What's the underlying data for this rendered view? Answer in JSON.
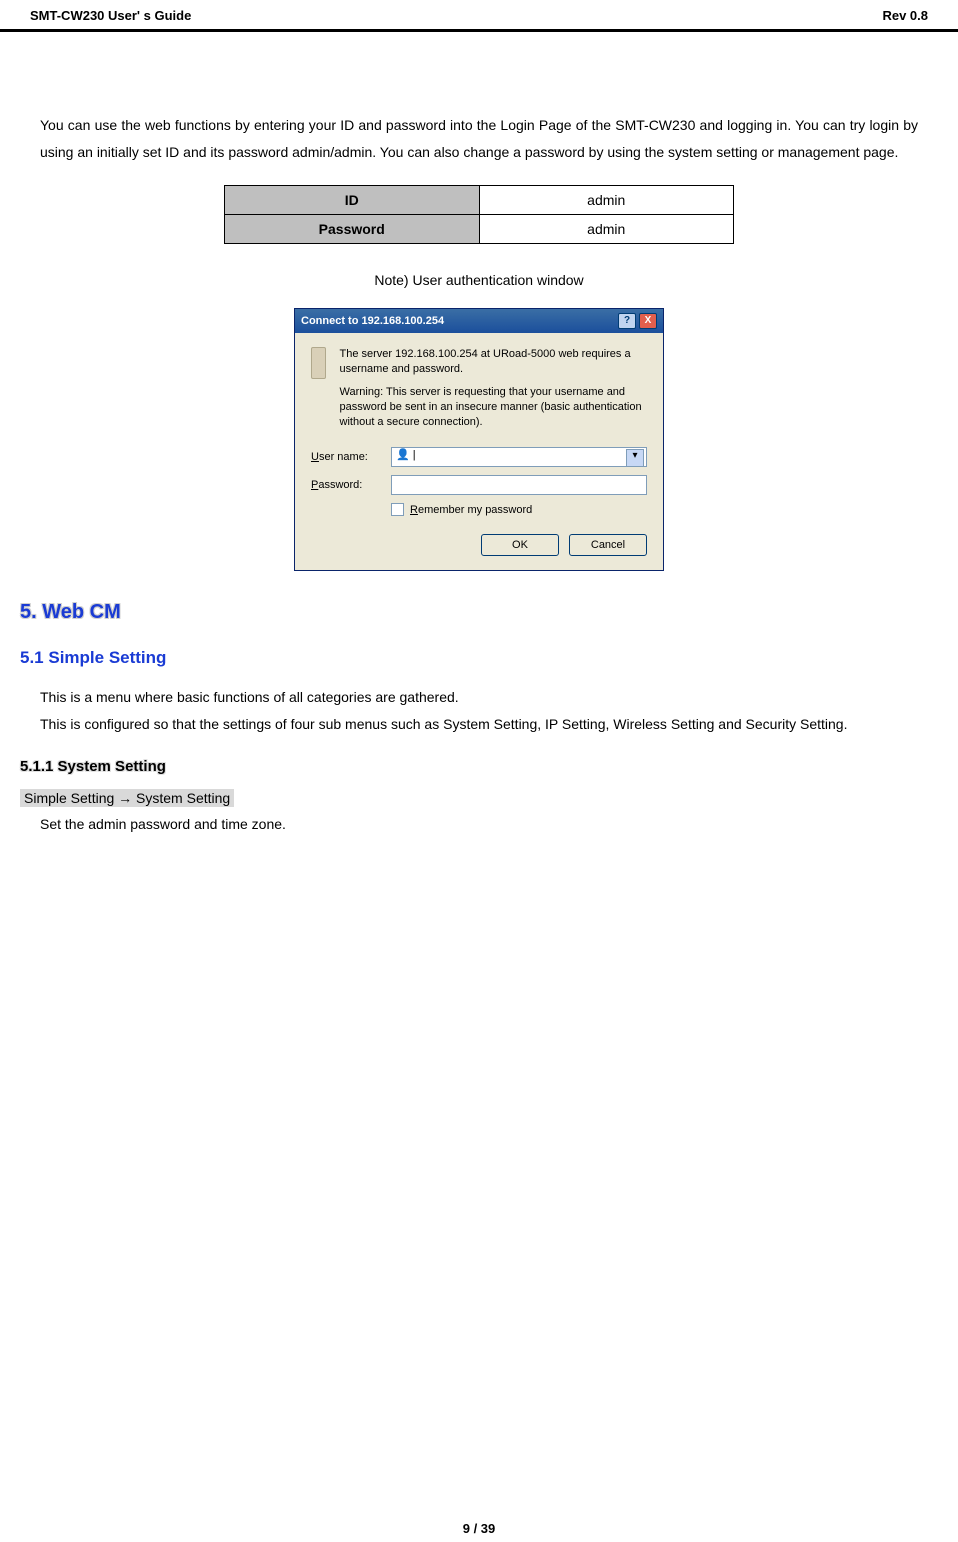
{
  "header": {
    "left": "SMT-CW230 User' s Guide",
    "right": "Rev 0.8"
  },
  "intro_paragraph": "You can use the web functions by entering your ID and password into the Login Page of the SMT-CW230 and logging in. You can try login by using an initially set ID and its password admin/admin. You can also change a password by using the system setting or management page.",
  "cred_table": {
    "id_label": "ID",
    "id_value": "admin",
    "pw_label": "Password",
    "pw_value": "admin"
  },
  "note_line": "Note)  User authentication window",
  "dialog": {
    "title": "Connect to 192.168.100.254",
    "help_glyph": "?",
    "close_glyph": "X",
    "line1": "The server 192.168.100.254 at URoad-5000 web requires a username and password.",
    "line2": "Warning: This server is requesting that your username and password be sent in an insecure manner (basic authentication without a secure connection).",
    "user_label_pre": "U",
    "user_label_rest": "ser name:",
    "pass_label_pre": "P",
    "pass_label_rest": "assword:",
    "remember_pre": "R",
    "remember_rest": "emember my password",
    "ok": "OK",
    "cancel": "Cancel",
    "user_icon_glyph": "👤"
  },
  "sec5": "5. Web CM",
  "sec51": "5.1 Simple Setting",
  "sec51_line1": "This is a menu where basic functions of all categories are gathered.",
  "sec51_line2": "This is configured so that the settings of four sub menus such as System Setting, IP Setting, Wireless Setting and Security Setting.",
  "sec511": "5.1.1 System Setting",
  "nav_path": "Simple Setting → System Setting",
  "sec511_line": "Set the admin password and time zone.",
  "footer": "9 / 39"
}
